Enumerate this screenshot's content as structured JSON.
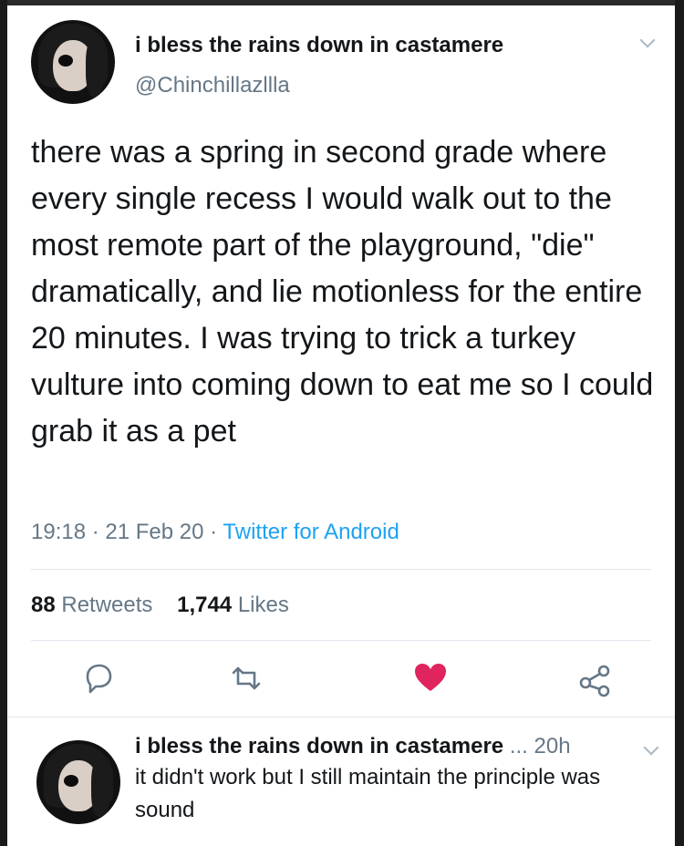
{
  "tweet": {
    "display_name": "i bless the rains down in castamere",
    "handle": "@Chinchillazllla",
    "text": "there was a spring in second grade where every single recess I would walk out to the most remote part of the playground, \"die\" dramatically, and lie motionless for the entire 20 minutes. I was trying to trick a turkey vulture into coming down to eat me so I could grab it as a pet",
    "time": "19:18",
    "date": "21 Feb 20",
    "source": "Twitter for Android",
    "separator": "·"
  },
  "stats": {
    "retweets_count": "88",
    "retweets_label": "Retweets",
    "likes_count": "1,744",
    "likes_label": "Likes"
  },
  "actions": {
    "reply_icon": "reply-icon",
    "retweet_icon": "retweet-icon",
    "like_icon": "heart-icon",
    "share_icon": "share-icon",
    "like_color": "#e0245e",
    "icon_color": "#657786"
  },
  "reply": {
    "display_name": "i bless the rains down in castamere",
    "dots": "...",
    "time": "20h",
    "text": "it didn't work but I still maintain the principle was sound"
  }
}
